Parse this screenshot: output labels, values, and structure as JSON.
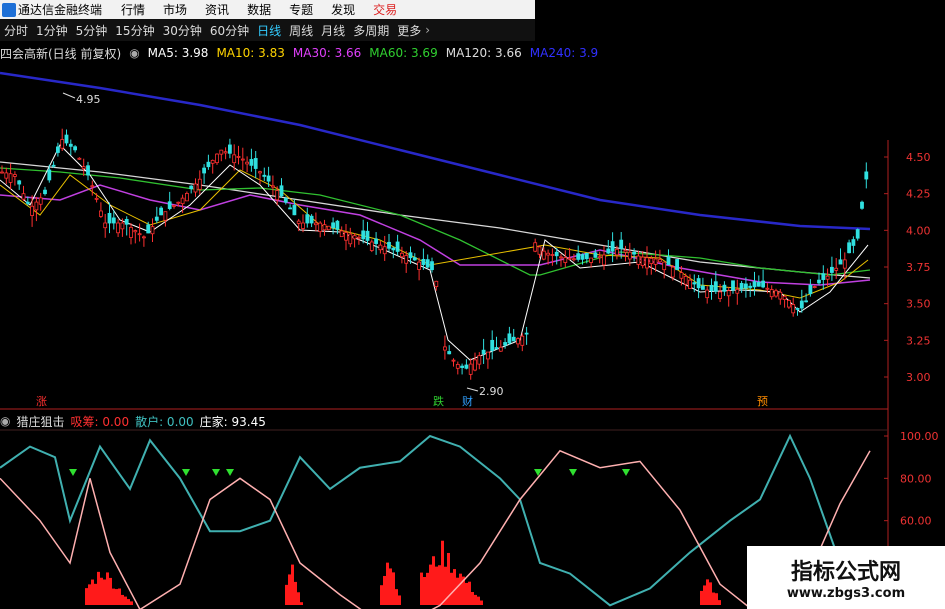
{
  "menubar": {
    "app_title": "通达信金融终端",
    "items": [
      "行情",
      "市场",
      "资讯",
      "数据",
      "专题",
      "发现",
      "交易"
    ]
  },
  "periods": [
    "分时",
    "1分钟",
    "5分钟",
    "15分钟",
    "30分钟",
    "60分钟",
    "日线",
    "周线",
    "月线",
    "多周期",
    "更多"
  ],
  "main_chart": {
    "title": "四会高新(日线 前复权)",
    "ma": [
      {
        "label": "MA5: 3.98",
        "color": "#ffffff"
      },
      {
        "label": "MA10: 3.83",
        "color": "#ffd400"
      },
      {
        "label": "MA30: 3.66",
        "color": "#e040fb"
      },
      {
        "label": "MA60: 3.69",
        "color": "#30d030"
      },
      {
        "label": "MA120: 3.66",
        "color": "#dddddd"
      },
      {
        "label": "MA240: 3.9",
        "color": "#3030ff"
      }
    ],
    "y_ticks": [
      "4.50",
      "4.25",
      "4.00",
      "3.75",
      "3.50",
      "3.25",
      "3.00"
    ],
    "high_mark": "4.95",
    "low_mark": "2.90",
    "tags": [
      {
        "text": "涨",
        "color": "#ff3030"
      },
      {
        "text": "跌",
        "color": "#30d030"
      },
      {
        "text": "财",
        "color": "#30a0ff"
      },
      {
        "text": "预",
        "color": "#ff8c00"
      }
    ]
  },
  "indicator": {
    "name": "猎庄狙击",
    "fields": [
      {
        "label": "吸筹: 0.00",
        "color": "#ff3030"
      },
      {
        "label": "散户: 0.00",
        "color": "#40c0c0"
      },
      {
        "label": "庄家: 93.45",
        "color": "#ffffff"
      }
    ],
    "y_ticks": [
      "100.00",
      "80.00",
      "60.00",
      "40.00"
    ]
  },
  "watermark": {
    "title": "指标公式网",
    "url": "www.zbgs3.com"
  },
  "colors": {
    "up": "#ff3030",
    "down": "#30e0e0",
    "axis": "#b02020",
    "retail": "#40c0c0",
    "banker": "#ffb0b0",
    "accumulate": "#ff2020",
    "signal": "#30e030"
  }
}
